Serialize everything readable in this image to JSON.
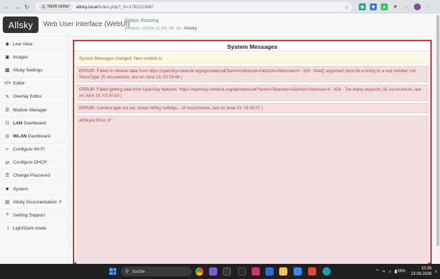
{
  "browser": {
    "security_chip": "Nicht sicher",
    "url_host": "allsky.local",
    "url_path": "/index.php?_ts=1782221687"
  },
  "header": {
    "logo": "Allsky",
    "brand": "Web User Interface (WebUI)",
    "status": "Status: Running",
    "version_label": "Version: v2024.12.06_06",
    "on_label": "on",
    "host": "Allsky"
  },
  "sidebar": {
    "items": [
      {
        "label": "Live View",
        "icon": "eye-icon"
      },
      {
        "label": "Images",
        "icon": "image-icon"
      },
      {
        "label": "Allsky Settings",
        "icon": "camera-icon"
      },
      {
        "label": "Editor",
        "icon": "code-icon"
      },
      {
        "label": "Overlay Editor",
        "icon": "edit-icon"
      },
      {
        "label": "Module Manager",
        "icon": "bars-icon"
      },
      {
        "bold": "LAN",
        "label": "Dashboard",
        "icon": "network-icon"
      },
      {
        "bold": "WLAN",
        "label": "Dashboard",
        "icon": "dot-circle-icon"
      },
      {
        "label": "Configure Wi-Fi",
        "icon": "wifi-icon"
      },
      {
        "label": "Configure DHCP",
        "icon": "exchange-icon"
      },
      {
        "label": "Change Password",
        "icon": "lock-icon"
      },
      {
        "label": "System",
        "icon": "cube-icon"
      },
      {
        "label": "Allsky Documentation",
        "icon": "book-icon"
      },
      {
        "label": "Getting Support",
        "icon": "question-icon"
      },
      {
        "label": "Light/Dark mode",
        "icon": "lightbulb-icon"
      }
    ]
  },
  "messages": {
    "title": "System Messages",
    "changed": "System Messages changed. New content is:",
    "items": [
      "ERROR: Failed to retrieve data from https://opensky-network.org/api/states/all?lamin=0&lamax=0&lomin=0&lomax=0 - 334 - float() argument must be a string or a real number, not 'NoneType'   (5 occurrences, last on June 23, 02:19:48 )",
      "ERROR: Failed getting data from OpenSky Network \"https://opensky-network.org/api/states/all?lamin=0&lamax=0&lomin=0&lomax=0\". 429 - Too many requests   (31 occurrences, last on June 23, 03:20:33 )",
      "ERROR: Camera type not set, check AllSky settings...   (9 occurrences, last on June 23, 03:35:07 )",
      "AllSkyAI Error: b''"
    ]
  },
  "taskbar": {
    "search_placeholder": "Suche",
    "battery": "19%",
    "time": "15:36",
    "date": "23.06.2026"
  },
  "colors": {
    "panel_border": "#d9302c",
    "error_bg": "#f2dede",
    "error_text": "#a94442",
    "warning_bg": "#fcf8e3",
    "status_green": "#3c9f3c"
  }
}
